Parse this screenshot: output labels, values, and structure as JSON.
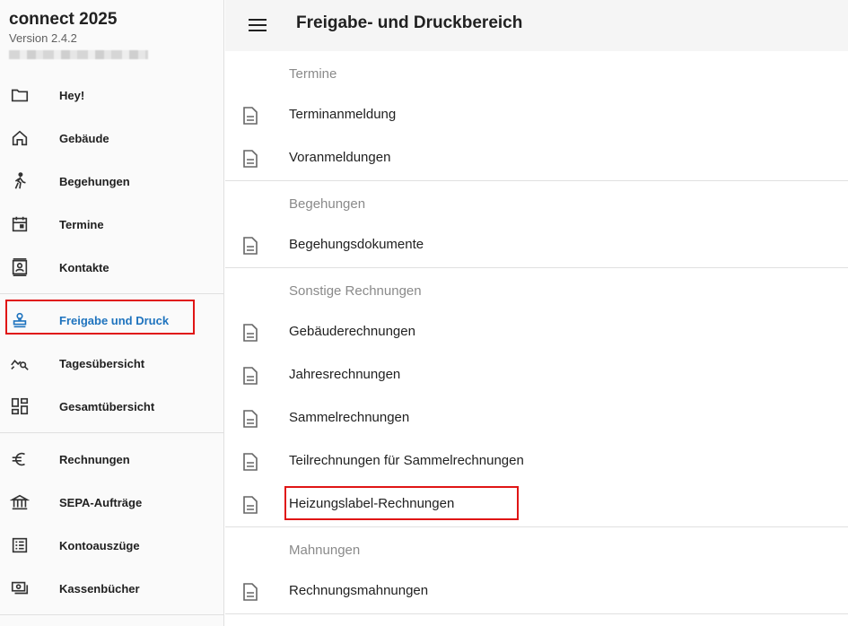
{
  "app": {
    "title": "connect 2025",
    "version": "Version 2.4.2"
  },
  "sidebar": {
    "groups": [
      {
        "items": [
          {
            "label": "Hey!",
            "icon": "folder-icon"
          },
          {
            "label": "Gebäude",
            "icon": "home-icon"
          },
          {
            "label": "Begehungen",
            "icon": "walk-icon"
          },
          {
            "label": "Termine",
            "icon": "calendar-icon"
          },
          {
            "label": "Kontakte",
            "icon": "contact-card-icon"
          }
        ]
      },
      {
        "items": [
          {
            "label": "Freigabe und Druck",
            "icon": "stamp-icon",
            "active": true
          },
          {
            "label": "Tagesübersicht",
            "icon": "chart-search-icon"
          },
          {
            "label": "Gesamtübersicht",
            "icon": "dashboard-icon"
          }
        ]
      },
      {
        "items": [
          {
            "label": "Rechnungen",
            "icon": "euro-icon"
          },
          {
            "label": "SEPA-Aufträge",
            "icon": "bank-icon"
          },
          {
            "label": "Kontoauszüge",
            "icon": "list-icon"
          },
          {
            "label": "Kassenbücher",
            "icon": "cash-icon"
          }
        ]
      }
    ]
  },
  "header": {
    "title": "Freigabe- und Druckbereich"
  },
  "sections": [
    {
      "title": "Termine",
      "items": [
        "Terminanmeldung",
        "Voranmeldungen"
      ]
    },
    {
      "title": "Begehungen",
      "items": [
        "Begehungsdokumente"
      ]
    },
    {
      "title": "Sonstige Rechnungen",
      "items": [
        "Gebäuderechnungen",
        "Jahresrechnungen",
        "Sammelrechnungen",
        "Teilrechnungen für Sammelrechnungen",
        "Heizungslabel-Rechnungen"
      ]
    },
    {
      "title": "Mahnungen",
      "items": [
        "Rechnungsmahnungen"
      ]
    }
  ],
  "colors": {
    "accent": "#1e73be",
    "highlight": "#e01515",
    "muted": "#8a8a8a"
  }
}
